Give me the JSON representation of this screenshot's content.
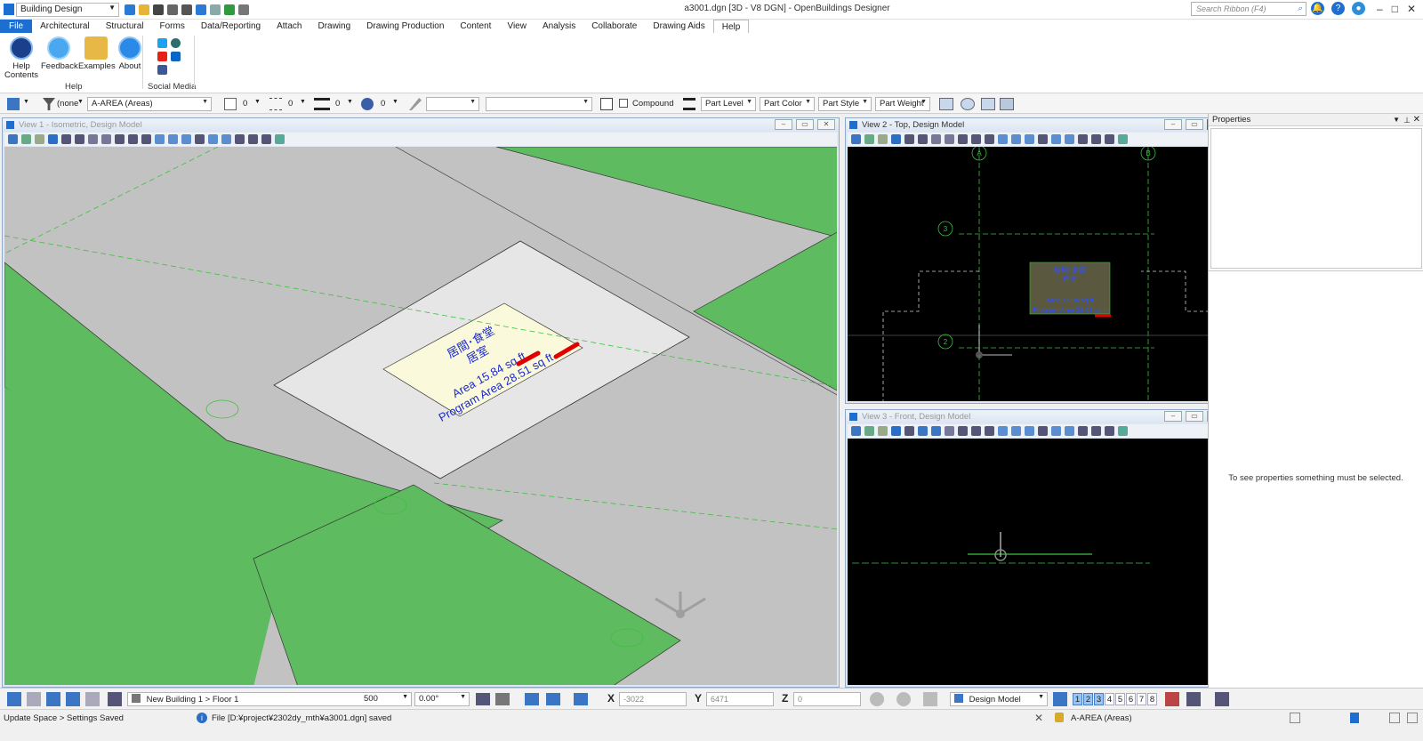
{
  "titlebar": {
    "workspace": "Building Design",
    "window_title": "a3001.dgn [3D - V8 DGN] - OpenBuildings Designer",
    "search_placeholder": "Search Ribbon (F4)"
  },
  "tabs": [
    "File",
    "Architectural",
    "Structural",
    "Forms",
    "Data/Reporting",
    "Attach",
    "Drawing",
    "Drawing Production",
    "Content",
    "View",
    "Analysis",
    "Collaborate",
    "Drawing Aids",
    "Help"
  ],
  "active_tab": "Help",
  "ribbon": {
    "help_contents": "Help Contents",
    "feedback": "Feedback",
    "examples": "Examples",
    "about": "About",
    "group_help": "Help",
    "group_social": "Social Media"
  },
  "attrbar": {
    "filter_value": "(none",
    "level": "A-AREA (Areas)",
    "color_num": "0",
    "style_num": "0",
    "weight_num": "0",
    "transparency_num": "0",
    "compound_label": "Compound",
    "part_level": "Part Level",
    "part_color": "Part Color",
    "part_style": "Part Style",
    "part_weight": "Part Weight"
  },
  "views": {
    "v1_title": "View 1 - Isometric, Design Model",
    "v2_title": "View 2 - Top, Design Model",
    "v3_title": "View 3 - Front, Design Model"
  },
  "room": {
    "name1": "居間･食堂",
    "name2": "居室",
    "area": "Area 15.84 sq ft",
    "program_area": "Program Area 28.51 sq ft"
  },
  "grid_labels": {
    "a": "A",
    "b": "B",
    "three": "3",
    "two": "2"
  },
  "properties": {
    "header": "Properties",
    "empty_msg": "To see properties something must be selected."
  },
  "bottombar": {
    "floor": "New Building 1 > Floor 1",
    "scale": "500",
    "angle": "0.00°",
    "x_label": "X",
    "x_value": "-3022",
    "y_label": "Y",
    "y_value": "6471",
    "z_label": "Z",
    "z_value": "0",
    "model": "Design Model",
    "view_numbers": [
      "1",
      "2",
      "3",
      "4",
      "5",
      "6",
      "7",
      "8"
    ]
  },
  "statusbar": {
    "left": "Update Space > Settings Saved",
    "message": "File [D:¥project¥2302dy_mth¥a3001.dgn] saved",
    "level": "A-AREA (Areas)"
  },
  "colors": {
    "accent": "#1c6fd1",
    "grass": "#5fbb5f",
    "slab": "#c8c8c8",
    "room_fill": "#fbf9dc",
    "room_text": "#1a2bcc",
    "markup": "#e00000",
    "grid_green": "#3fbf3f"
  }
}
